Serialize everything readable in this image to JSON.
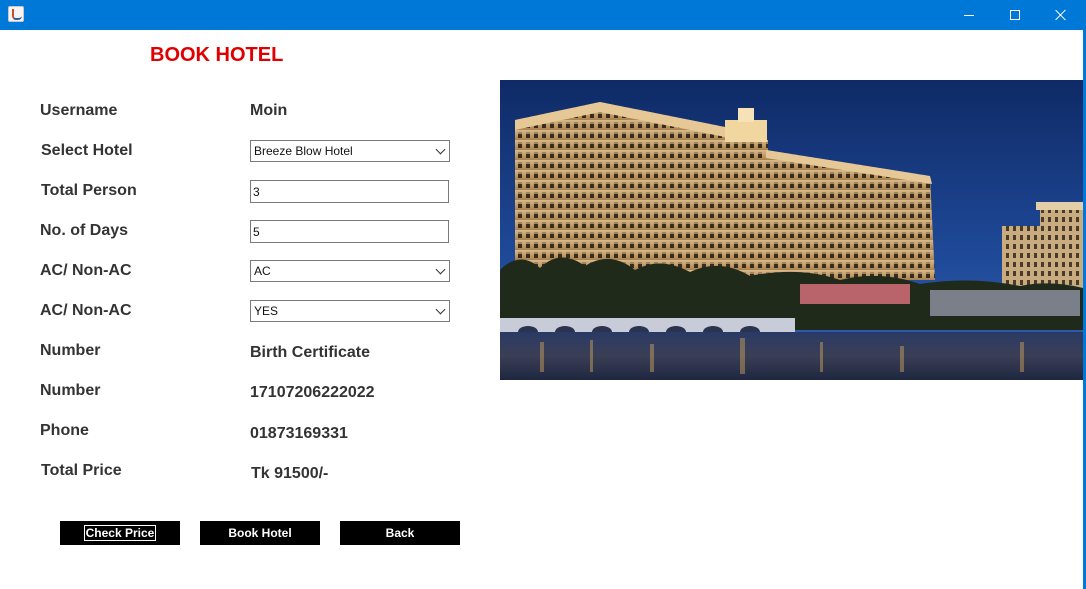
{
  "window": {
    "icon": "java-coffee-icon",
    "controls": [
      "minimize-icon",
      "maximize-icon",
      "close-icon"
    ]
  },
  "header": {
    "title": "BOOK HOTEL",
    "title_color": "#e00000"
  },
  "form": {
    "username": {
      "label": "Username",
      "value": "Moin"
    },
    "hotel": {
      "label": "Select Hotel",
      "selected": "Breeze Blow Hotel"
    },
    "persons": {
      "label": "Total Person",
      "value": "3"
    },
    "days": {
      "label": "No. of Days",
      "value": "5"
    },
    "ac": {
      "label": "AC/ Non-AC",
      "selected": "AC"
    },
    "food": {
      "label": "AC/ Non-AC",
      "selected": "YES"
    },
    "id_type": {
      "label": "Number",
      "value": "Birth Certificate"
    },
    "id_number": {
      "label": "Number",
      "value": "17107206222022"
    },
    "phone": {
      "label": "Phone",
      "value": "01873169331"
    },
    "total_price": {
      "label": "Total Price",
      "value": "Tk 91500/-"
    }
  },
  "buttons": {
    "check_price": "Check Price",
    "book_hotel": "Book Hotel",
    "back": "Back"
  },
  "colors": {
    "titlebar": "#0078d7",
    "button_bg": "#000000",
    "button_text": "#ffffff"
  }
}
